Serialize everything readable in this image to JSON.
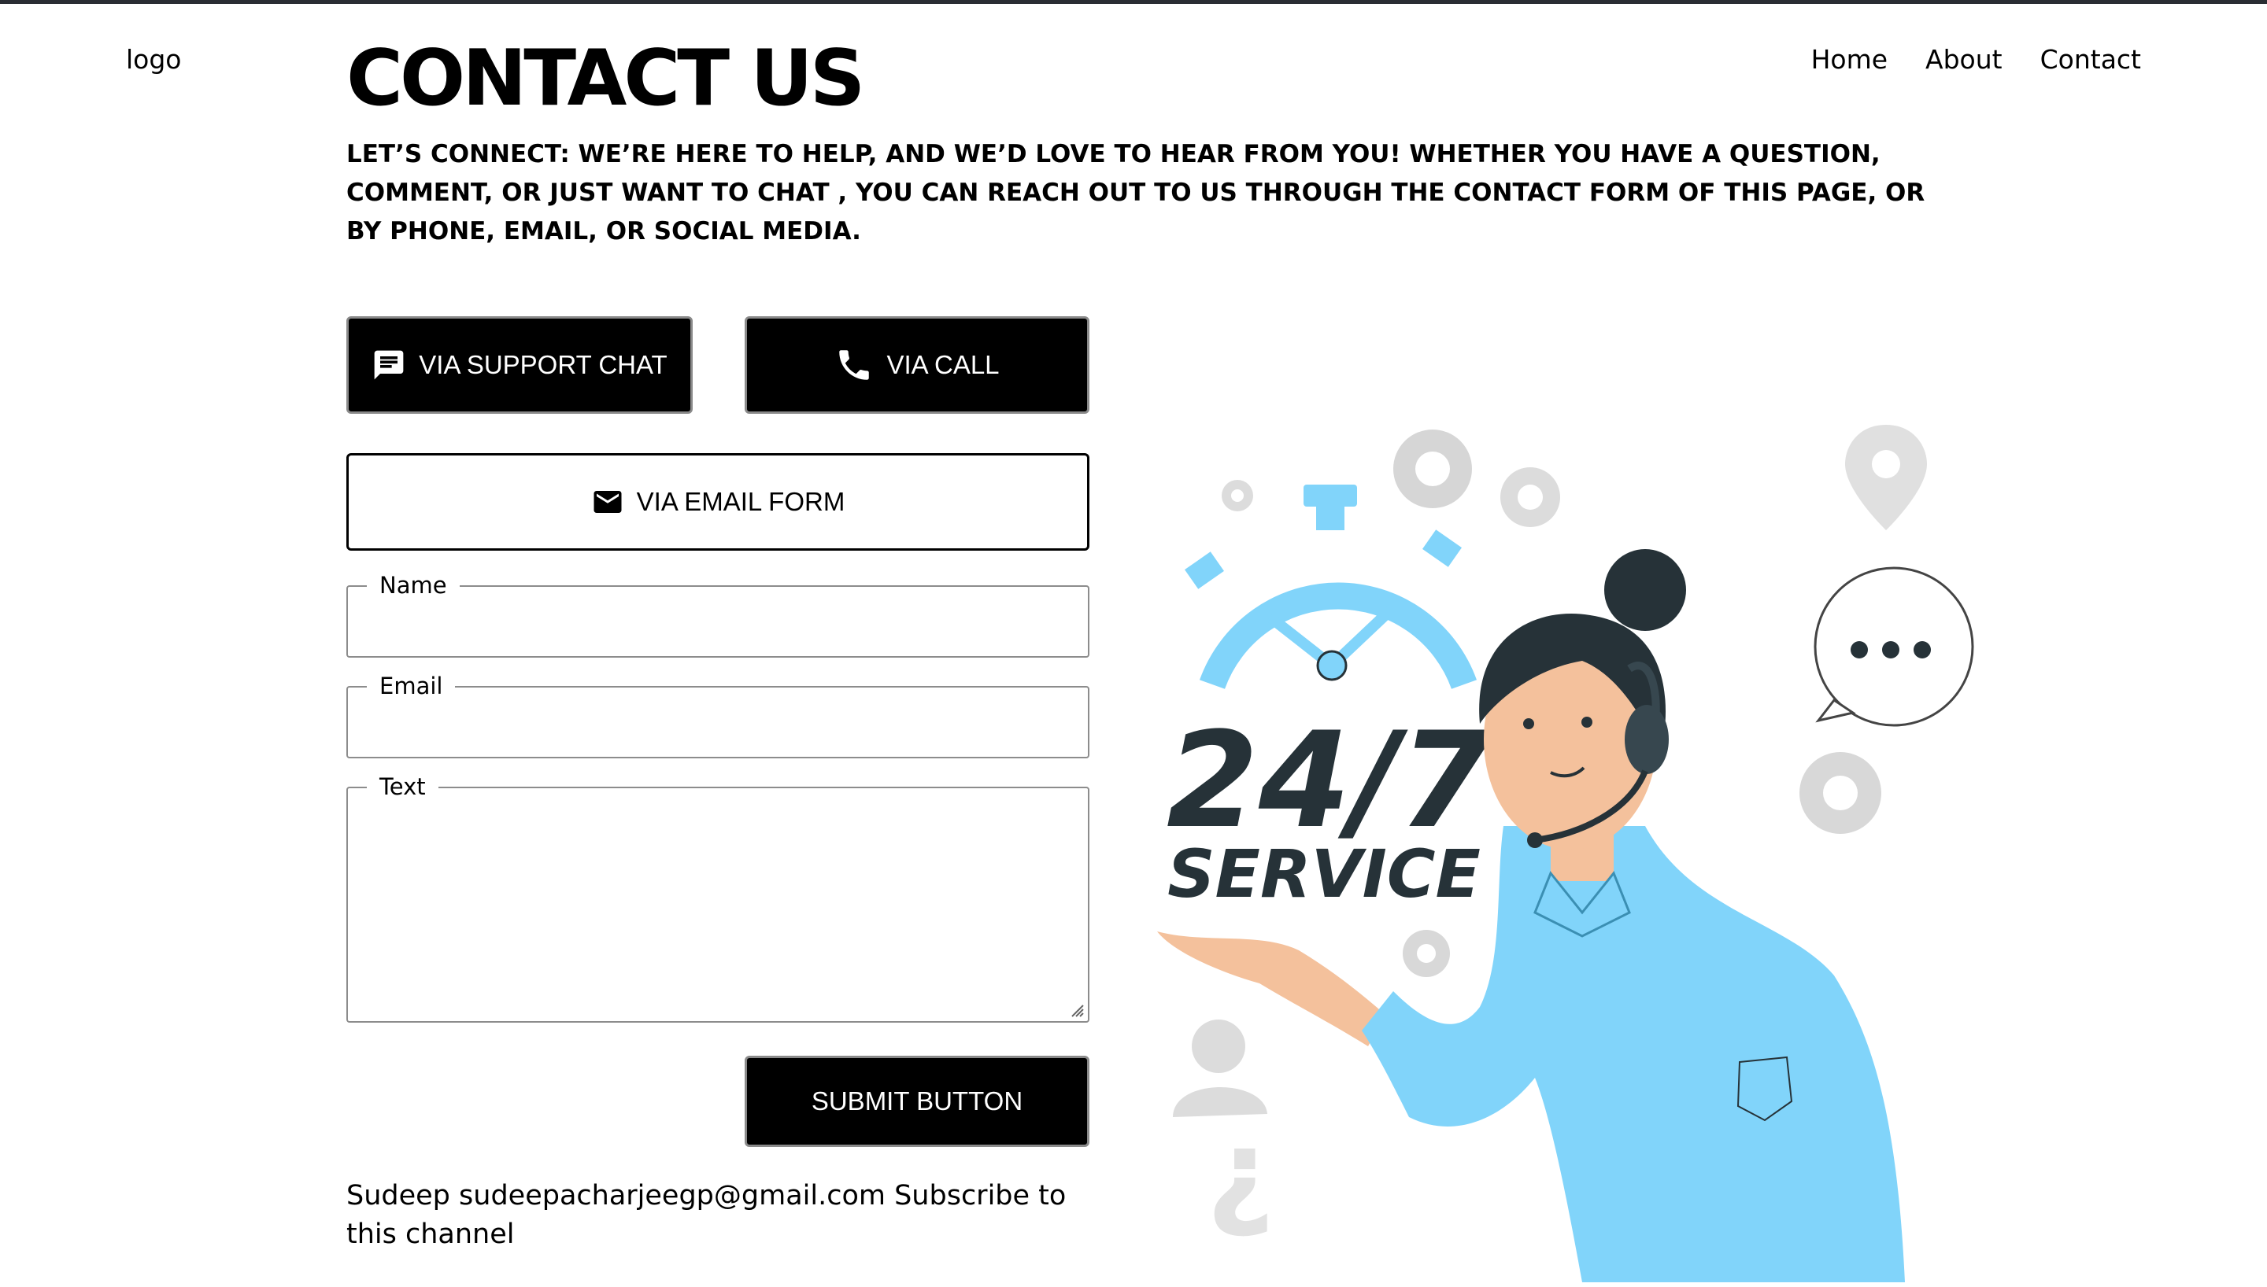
{
  "header": {
    "logo": "logo",
    "nav": [
      {
        "label": "Home"
      },
      {
        "label": "About"
      },
      {
        "label": "Contact"
      }
    ]
  },
  "page": {
    "title": "CONTACT US",
    "intro": "LET’S CONNECT: WE’RE HERE TO HELP, AND WE’D LOVE TO HEAR FROM YOU! WHETHER YOU HAVE A QUESTION, COMMENT, OR JUST WANT TO CHAT , YOU CAN REACH OUT TO US THROUGH THE CONTACT FORM OF THIS PAGE, OR BY PHONE, EMAIL, OR SOCIAL MEDIA."
  },
  "buttons": {
    "support_chat": {
      "label": "VIA SUPPORT CHAT",
      "icon": "chat-icon"
    },
    "call": {
      "label": "VIA CALL",
      "icon": "phone-icon"
    },
    "email_form": {
      "label": "VIA EMAIL FORM",
      "icon": "mail-icon"
    },
    "submit": {
      "label": "SUBMIT BUTTON"
    }
  },
  "form": {
    "name": {
      "legend": "Name",
      "value": ""
    },
    "email": {
      "legend": "Email",
      "value": ""
    },
    "text": {
      "legend": "Text",
      "value": ""
    }
  },
  "footer": {
    "note": "Sudeep sudeepacharjeegp@gmail.com Subscribe to this channel"
  },
  "illustration": {
    "headline": "24/7",
    "subline": "SERVICE",
    "colors": {
      "accent": "#81d4fa",
      "dark": "#263238",
      "skin": "#f4c19c",
      "gear": "#dcdcdc"
    }
  }
}
